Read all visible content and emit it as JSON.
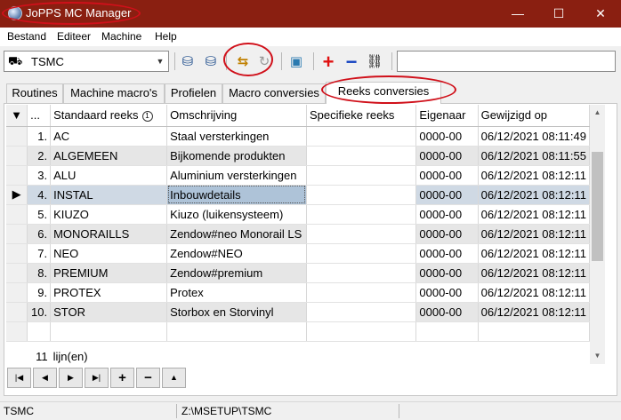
{
  "window": {
    "title": "JoPPS MC Manager",
    "minimize": "—",
    "maximize": "☐",
    "close": "✕"
  },
  "menu": [
    "Bestand",
    "Editeer",
    "Machine",
    "Help"
  ],
  "toolbar": {
    "machine_icon": "⛟",
    "machine_value": "TSMC",
    "dropdown_arrow": "▼",
    "buttons": {
      "db_export": "⛁",
      "db_import": "⛁",
      "reeks_import": "⇆",
      "refresh": "↻",
      "package": "▣",
      "add": "+",
      "remove": "−",
      "link": "⛓"
    },
    "search_value": ""
  },
  "tabs": [
    "Routines",
    "Machine macro's",
    "Profielen",
    "Macro conversies",
    "Reeks conversies"
  ],
  "active_tab": "Reeks conversies",
  "grid": {
    "menu_glyph": "▼",
    "columns": [
      "...",
      "Standaard reeks",
      "Omschrijving",
      "Specifieke reeks",
      "Eigenaar",
      "Gewijzigd op"
    ],
    "sort_badge": "1",
    "rows": [
      {
        "nr": "1.",
        "reeks": "AC",
        "oms": "Staal versterkingen",
        "spec": "",
        "eig": "0000-00",
        "date": "06/12/2021 08:11:49"
      },
      {
        "nr": "2.",
        "reeks": "ALGEMEEN",
        "oms": "Bijkomende produkten",
        "spec": "",
        "eig": "0000-00",
        "date": "06/12/2021 08:11:55"
      },
      {
        "nr": "3.",
        "reeks": "ALU",
        "oms": "Aluminium versterkingen",
        "spec": "",
        "eig": "0000-00",
        "date": "06/12/2021 08:12:11"
      },
      {
        "nr": "4.",
        "reeks": "INSTAL",
        "oms": "Inbouwdetails",
        "spec": "",
        "eig": "0000-00",
        "date": "06/12/2021 08:12:11"
      },
      {
        "nr": "5.",
        "reeks": "KIUZO",
        "oms": "Kiuzo (luikensysteem)",
        "spec": "",
        "eig": "0000-00",
        "date": "06/12/2021 08:12:11"
      },
      {
        "nr": "6.",
        "reeks": "MONORAILLS",
        "oms": "Zendow#neo Monorail LS",
        "spec": "",
        "eig": "0000-00",
        "date": "06/12/2021 08:12:11"
      },
      {
        "nr": "7.",
        "reeks": "NEO",
        "oms": "Zendow#NEO",
        "spec": "",
        "eig": "0000-00",
        "date": "06/12/2021 08:12:11"
      },
      {
        "nr": "8.",
        "reeks": "PREMIUM",
        "oms": "Zendow#premium",
        "spec": "",
        "eig": "0000-00",
        "date": "06/12/2021 08:12:11"
      },
      {
        "nr": "9.",
        "reeks": "PROTEX",
        "oms": "Protex",
        "spec": "",
        "eig": "0000-00",
        "date": "06/12/2021 08:12:11"
      },
      {
        "nr": "10.",
        "reeks": "STOR",
        "oms": "Storbox en Storvinyl",
        "spec": "",
        "eig": "0000-00",
        "date": "06/12/2021 08:12:11"
      }
    ],
    "selected_index": 3,
    "row_pointer": "▶",
    "footer_count": "11",
    "footer_label": "lijn(en)"
  },
  "scrollbar": {
    "up": "▲",
    "down": "▼"
  },
  "navigator": [
    "|◀",
    "◀",
    "▶",
    "▶|",
    "+",
    "−",
    "▲"
  ],
  "status": {
    "left": "TSMC",
    "path": "Z:\\MSETUP\\TSMC"
  },
  "colors": {
    "titlebar": "#8a1f11",
    "annotation": "#d0101a",
    "selection": "#aec3d8"
  }
}
